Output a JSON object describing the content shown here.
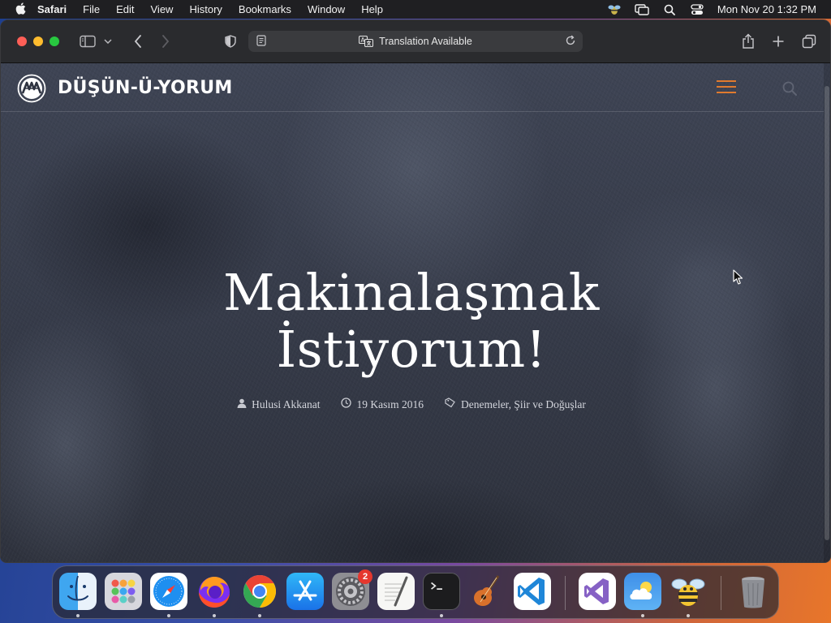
{
  "menubar": {
    "app_name": "Safari",
    "items": [
      "File",
      "Edit",
      "View",
      "History",
      "Bookmarks",
      "Window",
      "Help"
    ],
    "clock": "Mon Nov 20  1:32 PM"
  },
  "browser": {
    "address_text": "Translation Available"
  },
  "site": {
    "logo_text": "DÜŞÜN-Ü-YORUM",
    "accent_color": "#e07a2e"
  },
  "article": {
    "title_line1": "Makinalaşmak",
    "title_line2": "İstiyorum!",
    "author": "Hulusi Akkanat",
    "date": "19 Kasım 2016",
    "categories": "Denemeler, Şiir ve Doğuşlar"
  },
  "dock": {
    "apps": [
      "finder",
      "launchpad",
      "safari",
      "firefox",
      "chrome",
      "app-store",
      "system-settings",
      "textedit",
      "terminal",
      "garageband",
      "vscode",
      "visual-studio",
      "weather",
      "cyberduck",
      "trash"
    ],
    "settings_badge": "2"
  }
}
